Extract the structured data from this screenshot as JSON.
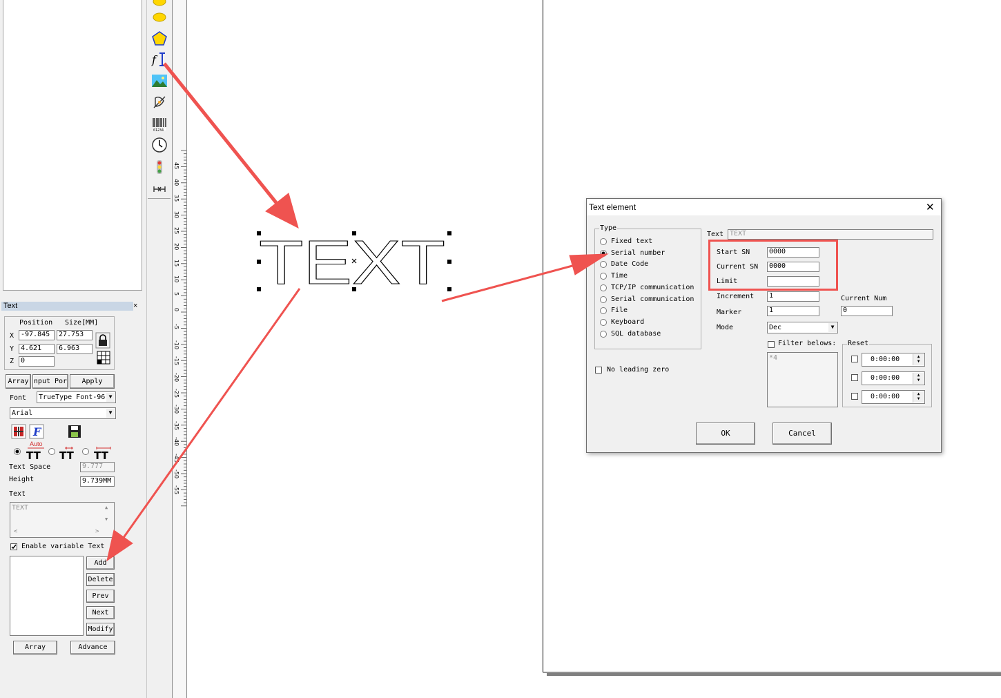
{
  "left_panel": {
    "title": "Text",
    "close_glyph": "×",
    "position_label": "Position",
    "size_label": "Size[MM]",
    "x_label": "X",
    "y_label": "Y",
    "z_label": "Z",
    "x_value": "-97.845",
    "y_value": "4.621",
    "z_value": "0",
    "width_value": "27.753",
    "height_value": "6.963",
    "array_button": "Array",
    "input_port_button": "nput Por",
    "apply_button": "Apply",
    "font_label": "Font",
    "font_type_value": "TrueType Font-96",
    "font_name_value": "Arial",
    "auto_label": "Auto",
    "text_space_label": "Text Space",
    "text_space_value": "9.777",
    "height_label": "Height",
    "height_field_value": "9.739MM",
    "text_label": "Text",
    "text_value": "TEXT",
    "enable_variable_label": "Enable variable Text",
    "add_button": "Add",
    "delete_button": "Delete",
    "prev_button": "Prev",
    "next_button": "Next",
    "modify_button": "Modify",
    "bottom_array_button": "Array",
    "advance_button": "Advance"
  },
  "ruler": {
    "labels": [
      "45",
      "40",
      "35",
      "30",
      "25",
      "20",
      "15",
      "10",
      "5",
      "0",
      "-5",
      "-10",
      "-15",
      "-20",
      "-25",
      "-30",
      "-35",
      "-40",
      "-45",
      "-50",
      "-55"
    ]
  },
  "canvas": {
    "text_object": "TEXT"
  },
  "dialog": {
    "title": "Text element",
    "close_glyph": "✕",
    "type_group_label": "Type",
    "types": [
      "Fixed text",
      "Serial number",
      "Date Code",
      "Time",
      "TCP/IP communication",
      "Serial communication",
      "File",
      "Keyboard",
      "SQL database"
    ],
    "selected_type": "Serial number",
    "no_leading_zero_label": "No leading zero",
    "text_label": "Text",
    "text_value": "TEXT",
    "start_sn_label": "Start SN",
    "start_sn_value": "0000",
    "current_sn_label": "Current SN",
    "current_sn_value": "0000",
    "limit_label": "Limit",
    "limit_value": "",
    "increment_label": "Increment",
    "increment_value": "1",
    "marker_label": "Marker",
    "marker_value": "1",
    "current_num_label": "Current Num",
    "current_num_value": "0",
    "mode_label": "Mode",
    "mode_value": "Dec",
    "filter_label": "Filter belows:",
    "filter_value": "*4",
    "reset_label": "Reset",
    "reset_times": [
      "0:00:00",
      "0:00:00",
      "0:00:00"
    ],
    "ok_button": "OK",
    "cancel_button": "Cancel"
  },
  "colors": {
    "annotation_red": "#ef5350",
    "title_highlight": "#c9d6e5"
  }
}
